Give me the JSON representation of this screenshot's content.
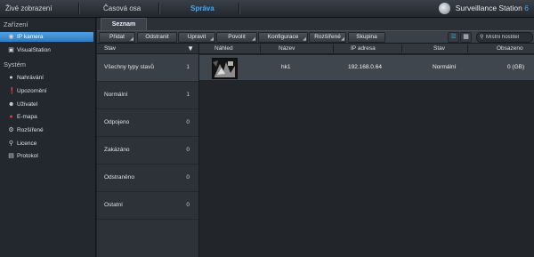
{
  "topbar": {
    "tabs": [
      "Živé zobrazení",
      "Časová osa",
      "Správa"
    ],
    "brand_name": "Surveillance Station",
    "brand_version": "6"
  },
  "sidebar": {
    "group1": "Zařízení",
    "group1_items": [
      {
        "label": "IP kamera",
        "icon": "camera-icon"
      },
      {
        "label": "VisualStation",
        "icon": "monitor-icon"
      }
    ],
    "group2": "Systém",
    "group2_items": [
      {
        "label": "Nahrávání",
        "icon": "record-icon"
      },
      {
        "label": "Upozornění",
        "icon": "alert-icon"
      },
      {
        "label": "Uživatel",
        "icon": "user-icon"
      },
      {
        "label": "E-mapa",
        "icon": "map-pin-icon"
      },
      {
        "label": "Rozšířené",
        "icon": "gear-icon"
      },
      {
        "label": "Licence",
        "icon": "key-icon"
      },
      {
        "label": "Protokol",
        "icon": "log-icon"
      }
    ]
  },
  "main": {
    "subtab": "Seznam",
    "toolbar": {
      "add": "Přidat",
      "remove": "Odstranit",
      "edit": "Upravit",
      "enable": "Povolit",
      "configure": "Konfigurace",
      "advanced": "Rozšířené",
      "group": "Skupina",
      "search_placeholder": "Místní hostitel"
    },
    "filter": {
      "header": "Stav",
      "rows": [
        {
          "label": "Všechny typy stavů",
          "count": "1"
        },
        {
          "label": "Normální",
          "count": "1"
        },
        {
          "label": "Odpojeno",
          "count": "0"
        },
        {
          "label": "Zakázáno",
          "count": "0"
        },
        {
          "label": "Odstraněno",
          "count": "0"
        },
        {
          "label": "Ostatní",
          "count": "0"
        }
      ]
    },
    "grid": {
      "columns": [
        "Náhled",
        "Název",
        "IP adresa",
        "Stav",
        "Obsazeno"
      ],
      "rows": [
        {
          "name": "hk1",
          "ip": "192.168.0.64",
          "status": "Normální",
          "used": "0 (GB)"
        }
      ]
    }
  },
  "colors": {
    "accent": "#4aa8f0",
    "sidebar_active": "#3a8ad6",
    "bg": "#1c2127"
  }
}
